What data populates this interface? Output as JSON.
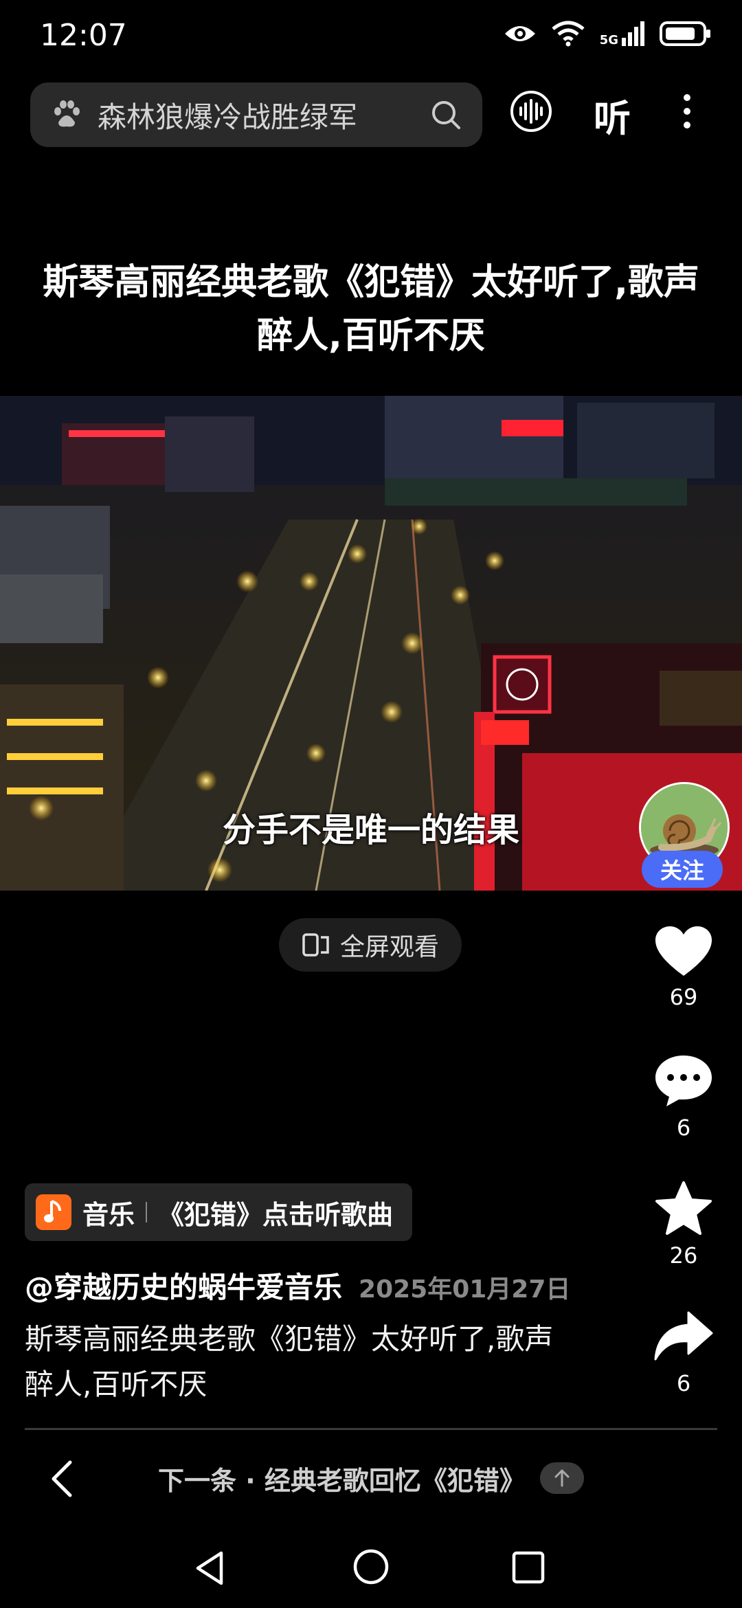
{
  "status_bar": {
    "time": "12:07",
    "network": "5G"
  },
  "search": {
    "query": "森林狼爆冷战胜绿军"
  },
  "header": {
    "listen_label": "听"
  },
  "video": {
    "title": "斯琴高丽经典老歌《犯错》太好听了,歌声醉人,百听不厌",
    "subtitle": "分手不是唯一的结果",
    "fullscreen_label": "全屏观看"
  },
  "author": {
    "follow_label": "关注",
    "name": "@穿越历史的蜗牛爱音乐",
    "date": "2025年01月27日"
  },
  "actions": {
    "likes": "69",
    "comments": "6",
    "favorites": "26",
    "shares": "6"
  },
  "music": {
    "label": "音乐",
    "song": "《犯错》点击听歌曲"
  },
  "description": {
    "line1": "斯琴高丽经典老歌《犯错》太好听了,歌声",
    "line2": "醉人,百听不厌"
  },
  "next": {
    "text": "下一条 · 经典老歌回忆《犯错》"
  },
  "colors": {
    "accent_follow": "#4a6cf7",
    "music_icon": "#ff6a1a",
    "background": "#000000"
  }
}
